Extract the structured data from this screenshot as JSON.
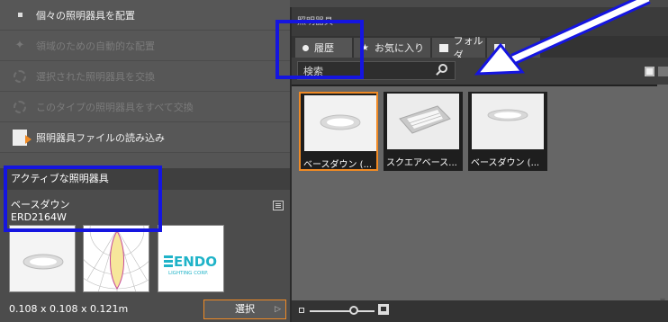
{
  "left_panel": {
    "menu": [
      {
        "label": "個々の照明器具を配置",
        "enabled": true
      },
      {
        "label": "領域のための自動的な配置",
        "enabled": false
      },
      {
        "label": "選択された照明器具を交換",
        "enabled": false
      },
      {
        "label": "このタイプの照明器具をすべて交換",
        "enabled": false
      },
      {
        "label": "照明器具ファイルの読み込み",
        "enabled": true
      }
    ],
    "active_header": "アクティブな照明器具",
    "fixture_name": "ベースダウン",
    "fixture_model": "ERD2164W",
    "logo_text": "ENDO",
    "logo_sub": "LIGHTING CORP.",
    "dimensions": "0.108 x 0.108 x 0.121m",
    "select_button": "選択"
  },
  "browser": {
    "title": "照明器具",
    "tabs": [
      {
        "label": "履歴",
        "icon": "dot-icon",
        "active": true
      },
      {
        "label": "お気に入り",
        "icon": "star-icon",
        "active": false
      },
      {
        "label": "フォルダ",
        "icon": "folder-icon",
        "active": false
      },
      {
        "label": "",
        "icon": "catalog-icon",
        "active": false
      }
    ],
    "search_value": "検索",
    "items": [
      {
        "label": "ベースダウン (...",
        "selected": true,
        "kind": "downlight"
      },
      {
        "label": "スクエアベース...",
        "selected": false,
        "kind": "square"
      },
      {
        "label": "ベースダウン (...",
        "selected": false,
        "kind": "downlight"
      }
    ]
  },
  "colors": {
    "accent": "#f08a24",
    "highlight": "#1515e0"
  }
}
